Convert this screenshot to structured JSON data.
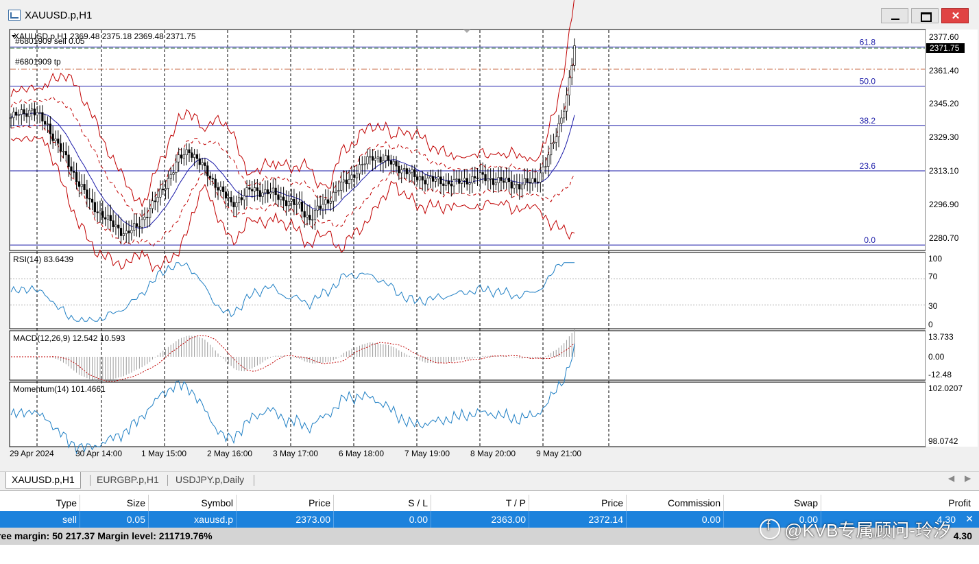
{
  "window": {
    "title": "XAUUSD.p,H1"
  },
  "chart": {
    "header": "XAUUSD.p,H1  2369.48 2375.18 2369.48 2371.75",
    "order_label": "#6801909 sell 0.05",
    "tp_label": "#6801909 tp",
    "current_price": "2371.75",
    "price_ticks": [
      "2377.60",
      "2361.40",
      "2345.20",
      "2329.30",
      "2313.10",
      "2296.90",
      "2280.70"
    ],
    "fib_levels": [
      {
        "label": "61.8",
        "price": 2373.5
      },
      {
        "label": "50.0",
        "price": 2355.0
      },
      {
        "label": "38.2",
        "price": 2336.3
      },
      {
        "label": "23.6",
        "price": 2314.8
      },
      {
        "label": "0.0",
        "price": 2279.6
      }
    ],
    "sell_price": 2373.0,
    "tp_price": 2363.0,
    "time_labels": [
      "29 Apr 2024",
      "30 Apr 14:00",
      "1 May 15:00",
      "2 May 16:00",
      "3 May 17:00",
      "6 May 18:00",
      "7 May 19:00",
      "8 May 20:00",
      "9 May 21:00"
    ],
    "colors": {
      "candle": "#000000",
      "bands": "#c00000",
      "ma": "#1a1aa8",
      "fib": "#1a1aa8",
      "indicator": "#1f7fc4",
      "macd_signal": "#c00000",
      "tp_line": "#c0542a",
      "sell_line": "#3a7a3a"
    }
  },
  "rsi": {
    "label": "RSI(14) 83.6439",
    "ticks": [
      "100",
      "70",
      "30",
      "0"
    ]
  },
  "macd": {
    "label": "MACD(12,26,9) 12.542 10.593",
    "ticks": [
      "13.733",
      "0.00",
      "-12.48"
    ]
  },
  "momentum": {
    "label": "Momentum(14) 101.4661",
    "ticks": [
      "102.0207",
      "98.0742"
    ]
  },
  "tabs": [
    {
      "label": "XAUUSD.p,H1"
    },
    {
      "label": "EURGBP.p,H1"
    },
    {
      "label": "USDJPY.p,Daily"
    }
  ],
  "terminal": {
    "columns": [
      "Type",
      "Size",
      "Symbol",
      "Price",
      "S / L",
      "T / P",
      "Price",
      "Commission",
      "Swap",
      "Profit"
    ],
    "row": {
      "type": "sell",
      "size": "0.05",
      "symbol": "xauusd.p",
      "price": "2373.00",
      "sl": "0.00",
      "tp": "2363.00",
      "current": "2372.14",
      "commission": "0.00",
      "swap": "0.00",
      "profit": "4.30"
    },
    "summary": "ree margin: 50 217.37  Margin level: 211719.76%",
    "summary_profit": "4.30"
  },
  "watermark": "@KVB专属顾问-玲汐"
}
